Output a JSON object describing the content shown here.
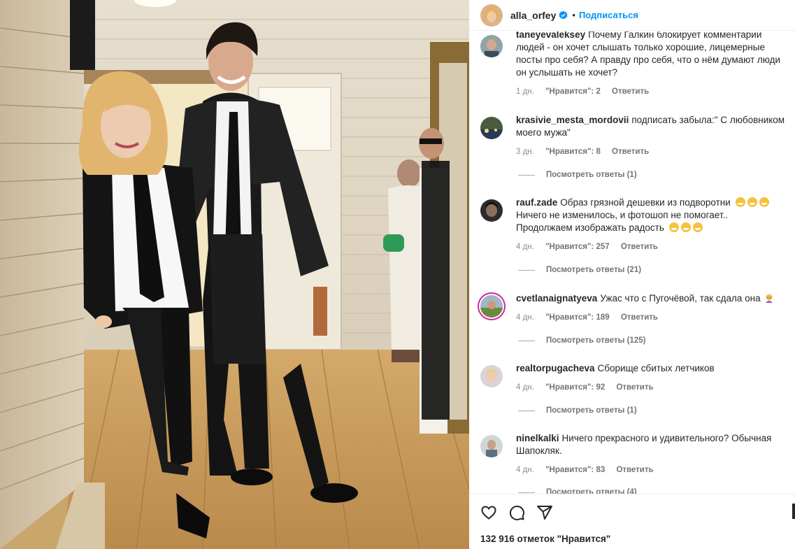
{
  "post": {
    "author": "alla_orfey",
    "verified": true,
    "separator": "•",
    "follow_label": "Подписаться",
    "likes_text": "132 916 отметок \"Нравится\""
  },
  "comments": [
    {
      "user": "taneyevaleksey",
      "text": "Почему Галкин блокирует комментарии людей - он хочет слышать только хорошие, лицемерные посты про себя? А правду про себя, что о нём думают люди он услышать не хочет?",
      "age": "1 дн.",
      "likes": "\"Нравится\": 2",
      "reply": "Ответить"
    },
    {
      "user": "krasivie_mesta_mordovii",
      "text": "подписать забыла:\" С любовником моего мужа\"",
      "age": "3 дн.",
      "likes": "\"Нравится\": 8",
      "reply": "Ответить",
      "view_replies": "Посмотреть ответы (1)"
    },
    {
      "user": "rauf.zade",
      "text": "Образ грязной дешевки из подворотни",
      "text2": "Ничего не изменилось, и фотошоп не помогает.. Продолжаем изображать радость",
      "age": "4 дн.",
      "likes": "\"Нравится\": 257",
      "reply": "Ответить",
      "view_replies": "Посмотреть ответы (21)"
    },
    {
      "user": "cvetlanaignatyeva",
      "text": "Ужас что с Пугочёвой, так сдала она",
      "age": "4 дн.",
      "likes": "\"Нравится\": 189",
      "reply": "Ответить",
      "view_replies": "Посмотреть ответы (125)"
    },
    {
      "user": "realtorpugacheva",
      "text": "Сборище сбитых летчиков",
      "age": "4 дн.",
      "likes": "\"Нравится\": 92",
      "reply": "Ответить",
      "view_replies": "Посмотреть ответы (1)"
    },
    {
      "user": "ninelkalki",
      "text": "Ничего прекрасного и удивительного? Обычная Шапокляк.",
      "age": "4 дн.",
      "likes": "\"Нравится\": 83",
      "reply": "Ответить",
      "view_replies": "Посмотреть ответы (4)"
    }
  ],
  "icons": {
    "like": "heart-icon",
    "comment": "comment-icon",
    "share": "send-icon",
    "verified": "verified-badge-icon",
    "emoji": "grimacing-face-emoji",
    "facepalm": "facepalm-emoji"
  },
  "colors": {
    "link_blue": "#0095f6",
    "text": "#262626",
    "meta": "#8e8e8e",
    "story_ring": "#d6249f"
  }
}
